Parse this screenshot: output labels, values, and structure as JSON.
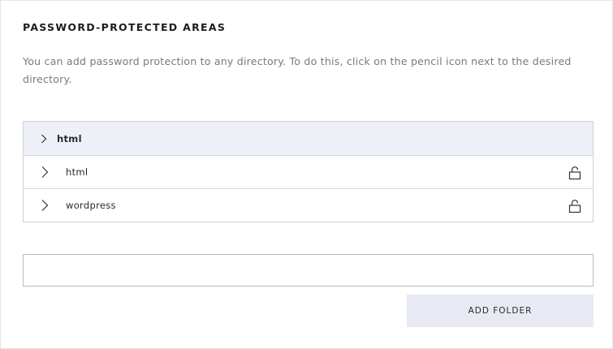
{
  "section": {
    "title": "PASSWORD-PROTECTED AREAS",
    "description": "You can add password protection to any directory. To do this, click on the pencil icon next to the desired directory."
  },
  "tree": {
    "root": {
      "label": "html",
      "icon": "chevron-right-icon"
    },
    "items": [
      {
        "label": "html",
        "expand_icon": "chevron-right-icon",
        "action_icon": "unlocked-padlock-icon"
      },
      {
        "label": "wordpress",
        "expand_icon": "chevron-right-icon",
        "action_icon": "unlocked-padlock-icon"
      }
    ]
  },
  "folder_input": {
    "value": "",
    "placeholder": ""
  },
  "add_folder": {
    "label": "ADD FOLDER"
  },
  "colors": {
    "root_row_bg": "#eef0f8",
    "button_bg": "#e7e9f3",
    "border": "#cfd1d8",
    "description_text": "#7a7a7a"
  }
}
